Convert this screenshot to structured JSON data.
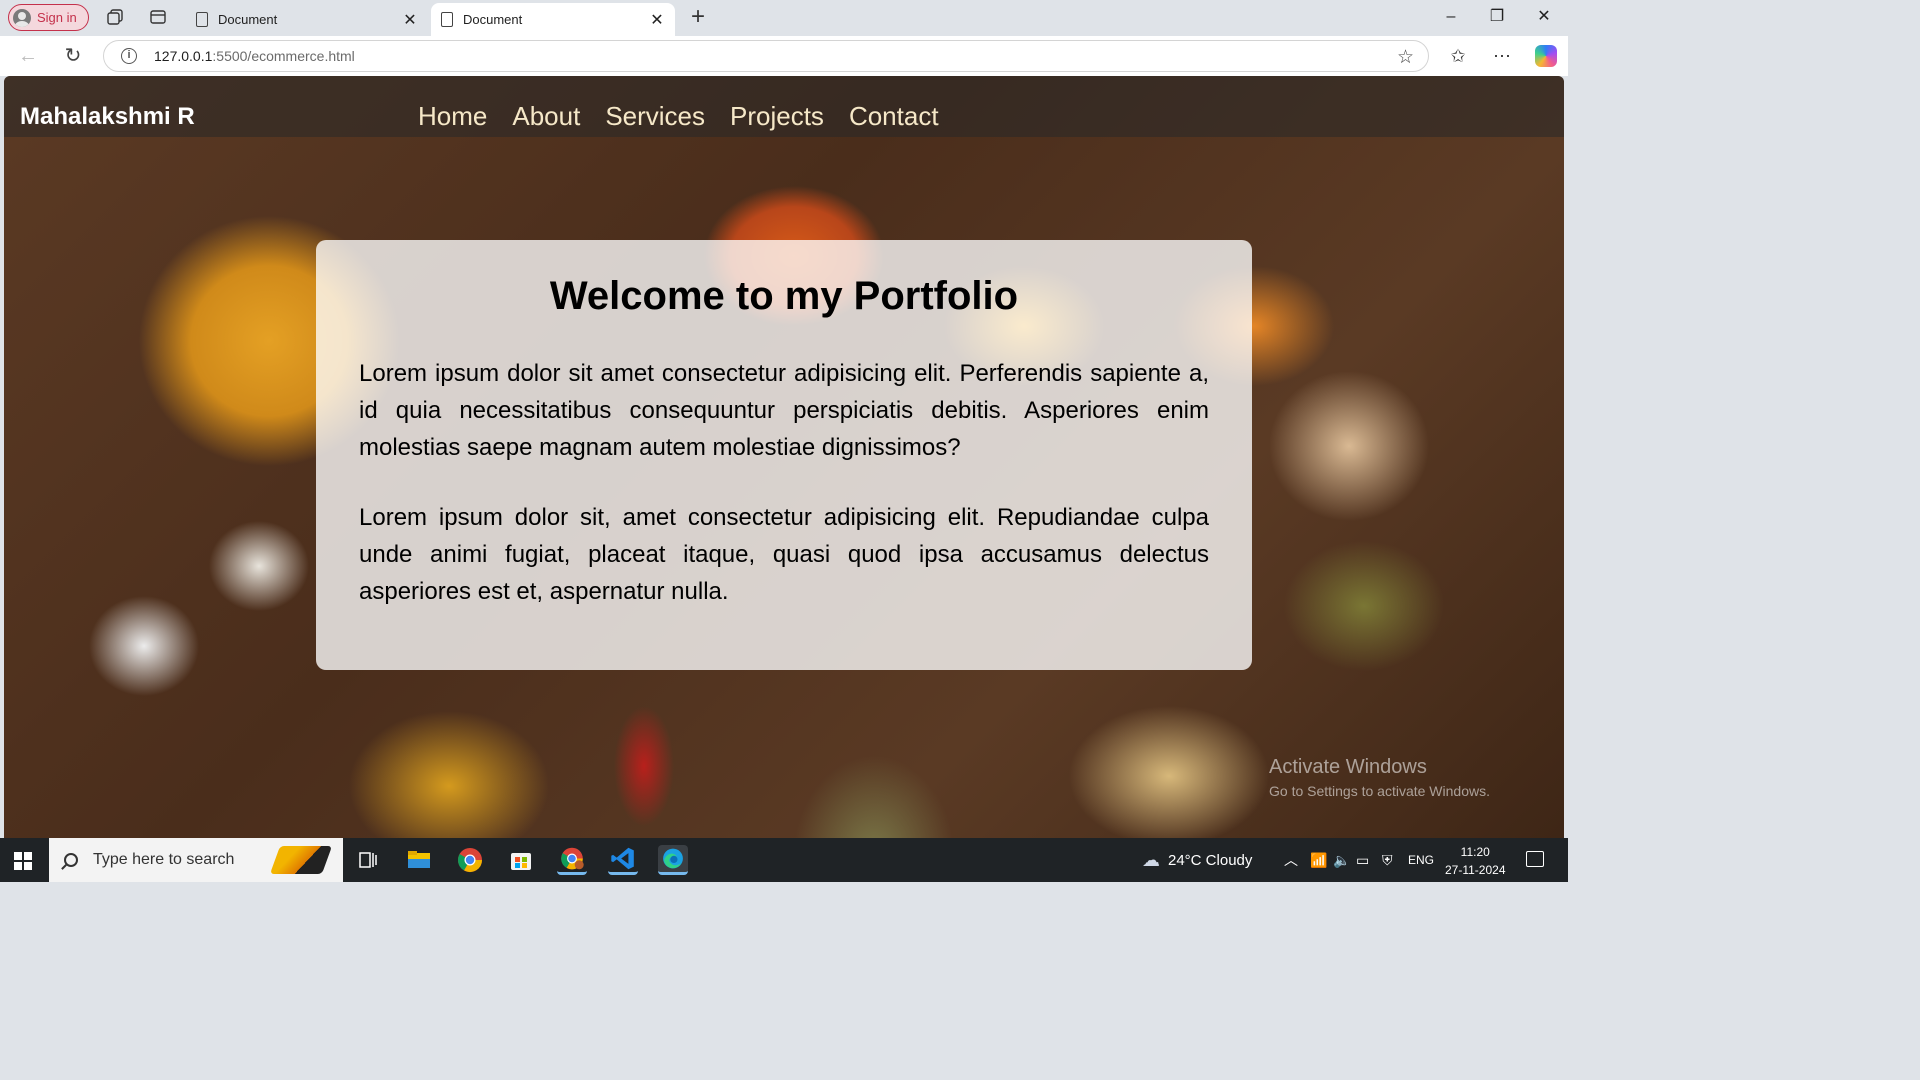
{
  "browser": {
    "signin_label": "Sign in",
    "tabs": [
      {
        "title": "Document",
        "active": false
      },
      {
        "title": "Document",
        "active": true
      }
    ],
    "url_host": "127.0.0.1",
    "url_path": ":5500/ecommerce.html",
    "icons": [
      "workspaces-icon",
      "tab-actions-icon",
      "back-icon",
      "refresh-icon",
      "info-icon",
      "favorite-star-icon",
      "favorites-icon",
      "more-icon",
      "copilot-icon"
    ]
  },
  "site": {
    "brand": "Mahalakshmi R",
    "nav": [
      "Home",
      "About",
      "Services",
      "Projects",
      "Contact"
    ],
    "heading": "Welcome to my Portfolio",
    "paragraphs": [
      "Lorem ipsum dolor sit amet consectetur adipisicing elit. Perferendis sapiente a, id quia necessitatibus consequuntur perspiciatis debitis. Asperiores enim molestias saepe magnam autem molestiae dignissimos?",
      "Lorem ipsum dolor sit, amet consectetur adipisicing elit. Repudiandae culpa unde animi fugiat, placeat itaque, quasi quod ipsa accusamus delectus asperiores est et, aspernatur nulla."
    ]
  },
  "watermark": {
    "line1": "Activate Windows",
    "line2": "Go to Settings to activate Windows."
  },
  "taskbar": {
    "search_placeholder": "Type here to search",
    "weather": "24°C  Cloudy",
    "language": "ENG",
    "time": "11:20",
    "date": "27-11-2024",
    "apps": [
      "task-view",
      "file-explorer",
      "chrome",
      "microsoft-store",
      "chrome-profile",
      "vscode",
      "edge"
    ]
  },
  "colors": {
    "accent_signin": "#c4314b",
    "nav_link": "#f6e8c8",
    "taskbar": "#1f2326"
  }
}
